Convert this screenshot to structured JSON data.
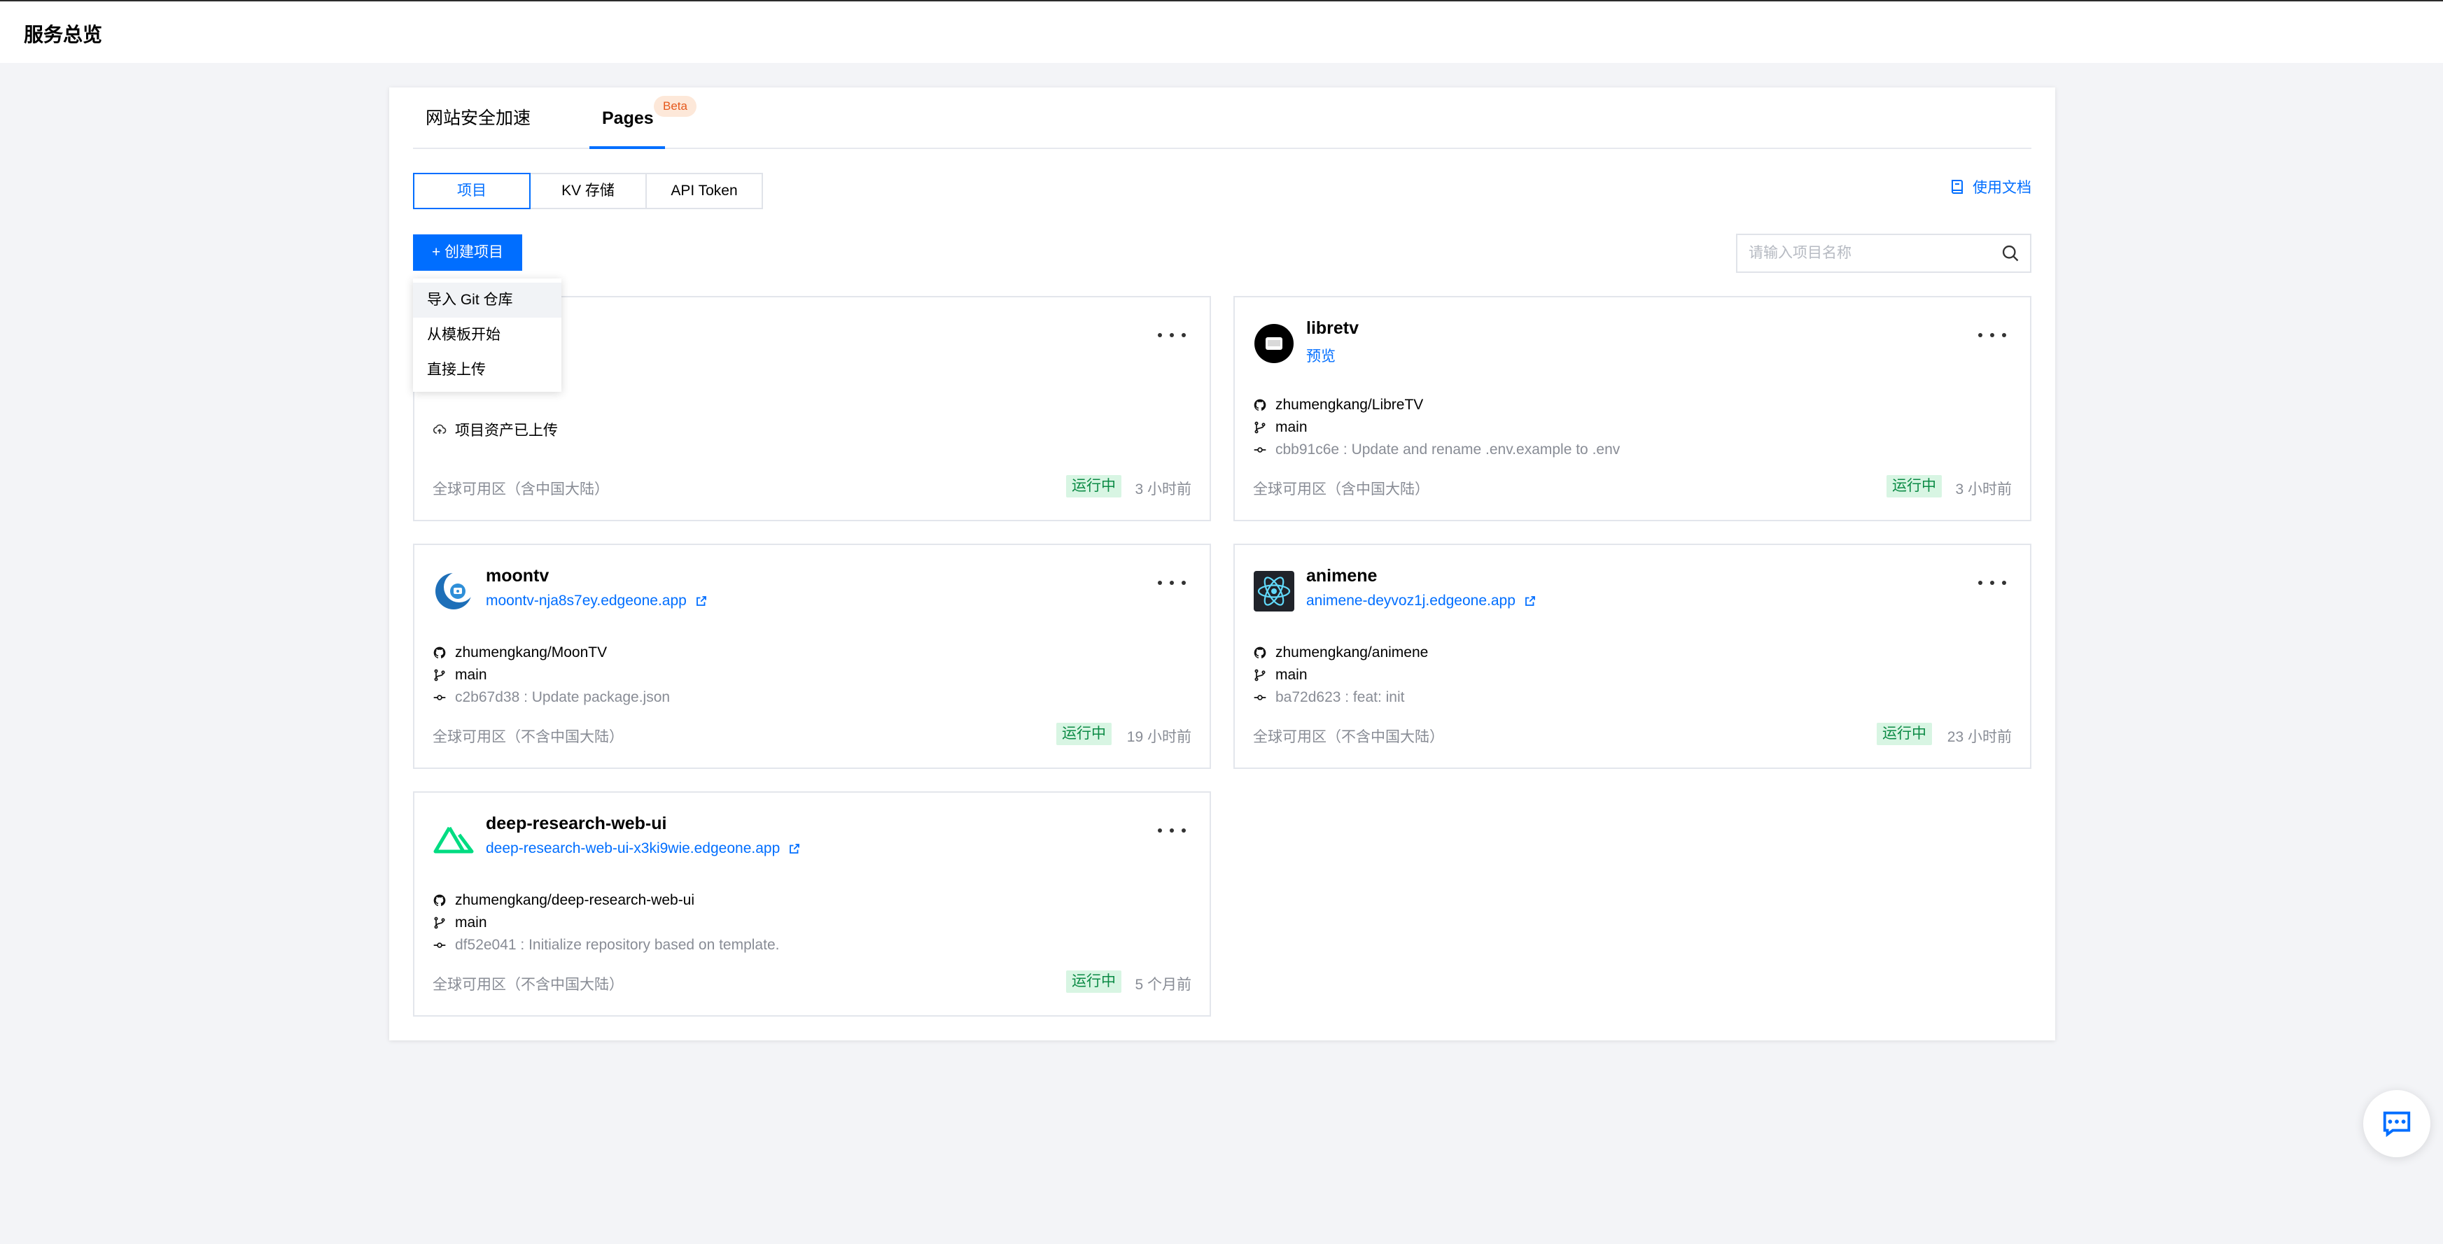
{
  "header": {
    "title": "服务总览"
  },
  "tabs": [
    {
      "label": "网站安全加速"
    },
    {
      "label": "Pages",
      "badge": "Beta"
    }
  ],
  "subtabs": [
    {
      "label": "项目",
      "active": true
    },
    {
      "label": "KV 存储"
    },
    {
      "label": "API Token"
    }
  ],
  "docs_link": "使用文档",
  "create_button": "+ 创建项目",
  "search": {
    "placeholder": "请输入项目名称",
    "value": ""
  },
  "dropdown": {
    "items": [
      "导入 Git 仓库",
      "从模板开始",
      "直接上传"
    ]
  },
  "cards": [
    {
      "upload_status": "项目资产已上传",
      "region": "全球可用区（含中国大陆）",
      "status": "运行中",
      "time": "3 小时前"
    },
    {
      "name": "libretv",
      "link": "预览",
      "repo": "zhumengkang/LibreTV",
      "branch": "main",
      "commit": "cbb91c6e : Update and rename .env.example to .env",
      "region": "全球可用区（含中国大陆）",
      "status": "运行中",
      "time": "3 小时前"
    },
    {
      "name": "moontv",
      "link": "moontv-nja8s7ey.edgeone.app",
      "repo": "zhumengkang/MoonTV",
      "branch": "main",
      "commit": "c2b67d38 : Update package.json",
      "region": "全球可用区（不含中国大陆）",
      "status": "运行中",
      "time": "19 小时前"
    },
    {
      "name": "animene",
      "link": "animene-deyvoz1j.edgeone.app",
      "repo": "zhumengkang/animene",
      "branch": "main",
      "commit": "ba72d623 : feat: init",
      "region": "全球可用区（不含中国大陆）",
      "status": "运行中",
      "time": "23 小时前"
    },
    {
      "name": "deep-research-web-ui",
      "link": "deep-research-web-ui-x3ki9wie.edgeone.app",
      "repo": "zhumengkang/deep-research-web-ui",
      "branch": "main",
      "commit": "df52e041 : Initialize repository based on template.",
      "region": "全球可用区（不含中国大陆）",
      "status": "运行中",
      "time": "5 个月前"
    }
  ],
  "colors": {
    "accent": "#006eff",
    "status_bg": "#d8f5e3",
    "status_text": "#0a8a44",
    "beta_bg": "#fde8d9",
    "beta_text": "#e5591d"
  }
}
